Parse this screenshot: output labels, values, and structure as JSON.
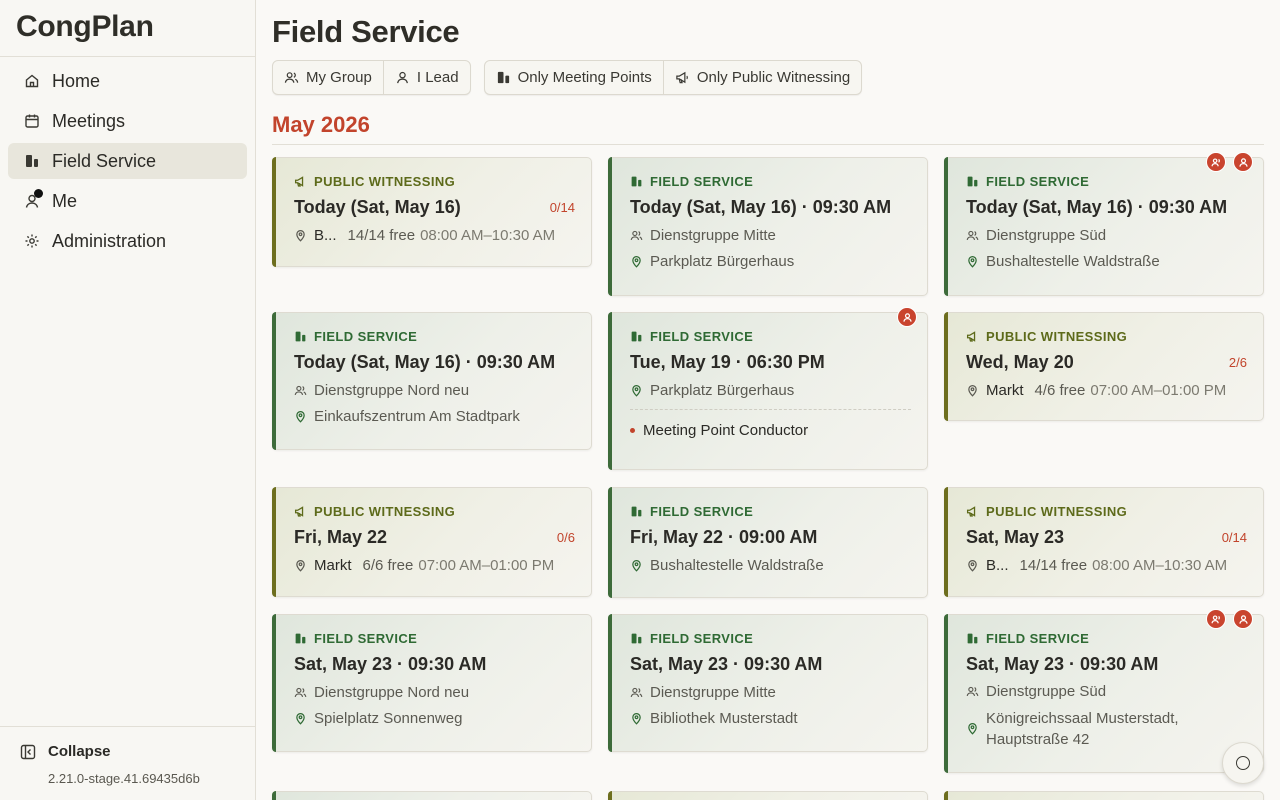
{
  "app": {
    "name": "CongPlan",
    "version": "2.21.0-stage.41.69435d6b"
  },
  "sidebar": {
    "items": [
      {
        "label": "Home",
        "icon": "home-icon",
        "active": false
      },
      {
        "label": "Meetings",
        "icon": "calendar-icon",
        "active": false
      },
      {
        "label": "Field Service",
        "icon": "field-service-icon",
        "active": true
      },
      {
        "label": "Me",
        "icon": "user-icon",
        "active": false
      },
      {
        "label": "Administration",
        "icon": "gear-icon",
        "active": false
      }
    ],
    "collapse_label": "Collapse"
  },
  "page": {
    "title": "Field Service",
    "filters": {
      "my_group": "My Group",
      "i_lead": "I Lead",
      "only_meeting_points": "Only Meeting Points",
      "only_public_witnessing": "Only Public Witnessing"
    },
    "month": "May 2026"
  },
  "cards": [
    {
      "type": "PUBLIC WITNESSING",
      "title": "Today (Sat, May 16)",
      "count": "0/14",
      "loc": "B...",
      "free": "14/14 free",
      "time": "08:00 AM–10:30 AM"
    },
    {
      "type": "FIELD SERVICE",
      "title": "Today (Sat, May 16) · 09:30 AM",
      "group": "Dienstgruppe Mitte",
      "place": "Parkplatz Bürgerhaus"
    },
    {
      "type": "FIELD SERVICE",
      "title": "Today (Sat, May 16) · 09:30 AM",
      "group": "Dienstgruppe Süd",
      "place": "Bushaltestelle Waldstraße"
    },
    {
      "type": "FIELD SERVICE",
      "title": "Today (Sat, May 16) · 09:30 AM",
      "group": "Dienstgruppe Nord neu",
      "place": "Einkaufszentrum Am Stadtpark"
    },
    {
      "type": "FIELD SERVICE",
      "title": "Tue, May 19 · 06:30 PM",
      "place": "Parkplatz Bürgerhaus",
      "role": "Meeting Point Conductor"
    },
    {
      "type": "PUBLIC WITNESSING",
      "title": "Wed, May 20",
      "count": "2/6",
      "loc": "Markt",
      "free": "4/6 free",
      "time": "07:00 AM–01:00 PM"
    },
    {
      "type": "PUBLIC WITNESSING",
      "title": "Fri, May 22",
      "count": "0/6",
      "loc": "Markt",
      "free": "6/6 free",
      "time": "07:00 AM–01:00 PM"
    },
    {
      "type": "FIELD SERVICE",
      "title": "Fri, May 22 · 09:00 AM",
      "place": "Bushaltestelle Waldstraße"
    },
    {
      "type": "PUBLIC WITNESSING",
      "title": "Sat, May 23",
      "count": "0/14",
      "loc": "B...",
      "free": "14/14 free",
      "time": "08:00 AM–10:30 AM"
    },
    {
      "type": "FIELD SERVICE",
      "title": "Sat, May 23 · 09:30 AM",
      "group": "Dienstgruppe Nord neu",
      "place": "Spielplatz Sonnenweg"
    },
    {
      "type": "FIELD SERVICE",
      "title": "Sat, May 23 · 09:30 AM",
      "group": "Dienstgruppe Mitte",
      "place": "Bibliothek Musterstadt"
    },
    {
      "type": "FIELD SERVICE",
      "title": "Sat, May 23 · 09:30 AM",
      "group": "Dienstgruppe Süd",
      "place": "Königreichssaal Musterstadt, Hauptstraße 42"
    }
  ],
  "colors": {
    "accent": "#c2442c",
    "field_service": "#3d6b3a",
    "public_witnessing": "#6d6e1e"
  }
}
